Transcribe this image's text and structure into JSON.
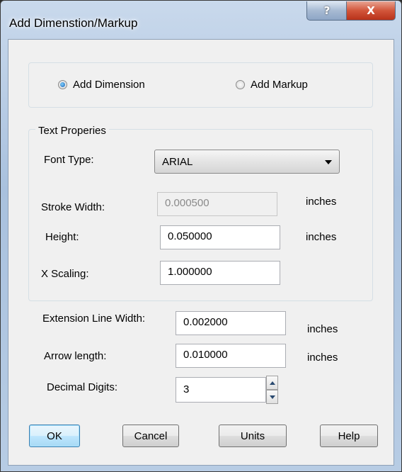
{
  "window": {
    "title": "Add Dimenstion/Markup",
    "help_glyph": "?",
    "close_glyph": "X"
  },
  "mode": {
    "option_dimension": "Add Dimension",
    "option_markup": "Add Markup",
    "selected": "Add Dimension"
  },
  "text_properties": {
    "legend": "Text Properies",
    "font_type_label": "Font Type:",
    "font_type_value": "ARIAL",
    "stroke_width_label": "Stroke Width:",
    "stroke_width_value": "0.000500",
    "stroke_width_unit": "inches",
    "height_label": "Height:",
    "height_value": "0.050000",
    "height_unit": "inches",
    "x_scaling_label": "X Scaling:",
    "x_scaling_value": "1.000000"
  },
  "lines": {
    "extension_label": "Extension Line Width:",
    "extension_value": "0.002000",
    "extension_unit": "inches",
    "arrow_label": "Arrow length:",
    "arrow_value": "0.010000",
    "arrow_unit": "inches",
    "decimal_label": "Decimal Digits:",
    "decimal_value": "3"
  },
  "buttons": {
    "ok": "OK",
    "cancel": "Cancel",
    "units": "Units",
    "help": "Help"
  },
  "colors": {
    "title_bar": "#b7cce4",
    "close": "#c7442a",
    "default_button": "#bee6fd"
  }
}
